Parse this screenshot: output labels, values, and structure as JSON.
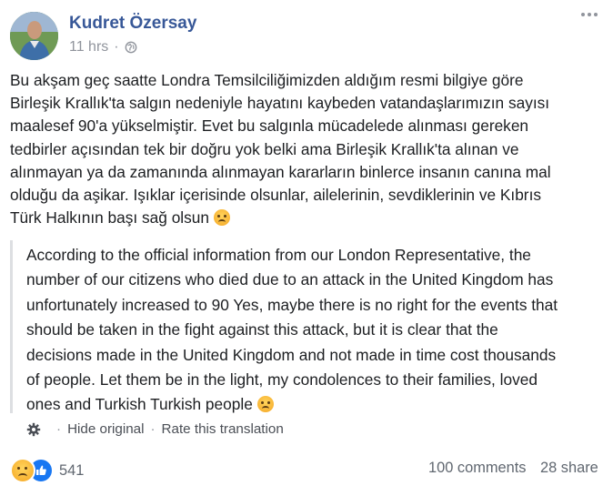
{
  "post": {
    "author": "Kudret Özersay",
    "time": "11 hrs",
    "privacy_icon": "globe-icon",
    "original_lines": [
      "Bu akşam geç saatte Londra Temsilciliğimizden aldığım resmi bilgiye göre",
      "Birleşik Krallık'ta salgın nedeniyle hayatını kaybeden vatandaşlarımızın sayısı",
      "maalesef 90'a yükselmiştir. Evet bu salgınla mücadelede alınması gereken",
      "tedbirler açısından tek bir doğru yok belki ama Birleşik Krallık'ta alınan ve",
      "alınmayan ya da zamanında alınmayan kararların binlerce insanın canına mal",
      "olduğu da aşikar. Işıklar içerisinde olsunlar, ailelerinin, sevdiklerinin ve Kıbrıs",
      "Türk Halkının başı sağ olsun"
    ],
    "translation_lines": [
      "According to the official information from our London Representative, the",
      "number of our citizens who died due to an attack in the United Kingdom has",
      "unfortunately increased to 90 Yes, maybe there is no right for the events that",
      "should be taken in the fight against this attack, but it is clear that the",
      "decisions made in the United Kingdom and not made in time cost thousands",
      "of people. Let them be in the light, my condolences to their families, loved",
      "ones and Turkish Turkish people"
    ],
    "hide_original": "Hide original",
    "rate_translation": "Rate this translation",
    "separator": "·"
  },
  "footer": {
    "reaction_count": "541",
    "reaction_icons": [
      "sad-reaction-icon",
      "like-reaction-icon"
    ],
    "comments": "100 comments",
    "shares": "28 share"
  },
  "colors": {
    "name": "#385898",
    "meta": "#90949c",
    "like": "#1877f2"
  }
}
